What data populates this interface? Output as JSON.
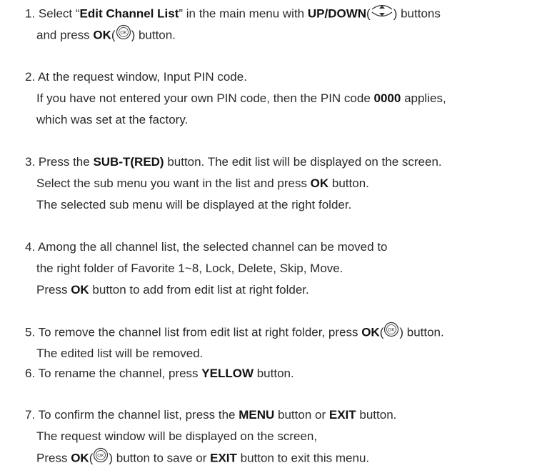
{
  "steps": [
    {
      "lines": [
        [
          "1. Select “",
          "Edit Channel List",
          "” in the main menu with ",
          "UP/DOWN",
          "(",
          ") buttons"
        ],
        [
          "and press ",
          "OK",
          "(",
          ") button."
        ]
      ]
    },
    {
      "lines": [
        [
          "2. At the request window, Input PIN code."
        ],
        [
          "If you have not entered your own PIN code, then the PIN code ",
          "0000",
          " applies,"
        ],
        [
          "which was set at the factory."
        ]
      ]
    },
    {
      "lines": [
        [
          "3. Press the ",
          "SUB-T(RED)",
          " button. The edit list will be displayed on the screen."
        ],
        [
          "Select the sub menu you want in the list and press ",
          "OK",
          " button."
        ],
        [
          "The selected sub menu will be displayed at the right folder."
        ]
      ]
    },
    {
      "lines": [
        [
          "4. Among the all channel list, the selected channel can be moved to"
        ],
        [
          "the right folder of Favorite 1~8, Lock, Delete, Skip, Move."
        ],
        [
          "Press ",
          "OK",
          " button to add from edit list at right folder."
        ]
      ]
    },
    {
      "lines": [
        [
          "5. To remove the channel list from edit list at right folder, press ",
          "OK",
          "(",
          ") button."
        ],
        [
          "The edited list will be removed."
        ]
      ]
    },
    {
      "lines": [
        [
          "6. To rename the channel, press ",
          "YELLOW",
          " button."
        ]
      ]
    },
    {
      "lines": [
        [
          "7. To confirm the channel list, press the ",
          "MENU",
          " button or ",
          "EXIT",
          " button."
        ],
        [
          "The request window will be displayed on the screen,"
        ],
        [
          "Press ",
          "OK",
          "(",
          ") button to save or ",
          "EXIT",
          " button to exit this menu."
        ]
      ]
    }
  ],
  "icons": {
    "updown": "up-down-arrows-icon",
    "ok": "ok-button-icon",
    "ok_label": "OK"
  }
}
